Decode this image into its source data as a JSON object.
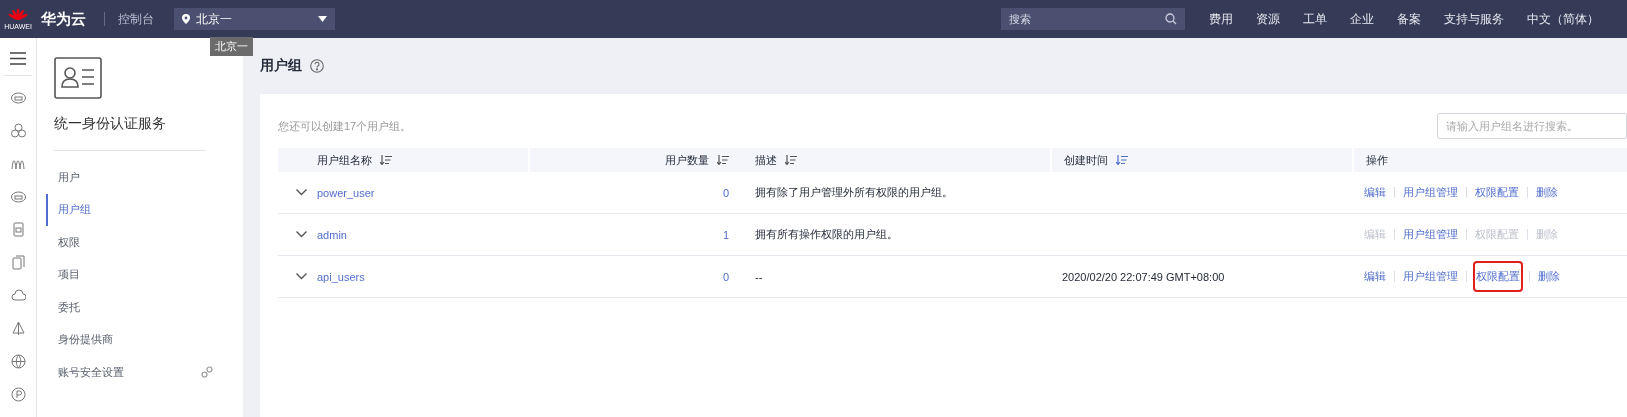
{
  "top_bar": {
    "logo_text": "HUAWEI",
    "brand": "华为云",
    "console": "控制台",
    "region": {
      "value": "北京一"
    },
    "region_tooltip": "北京一",
    "search": {
      "placeholder": "搜索"
    },
    "nav": [
      "费用",
      "资源",
      "工单",
      "企业",
      "备案",
      "支持与服务",
      "中文（简体）"
    ]
  },
  "sidebar": {
    "title": "统一身份认证服务",
    "items": [
      {
        "label": "用户",
        "selected": false,
        "link_icon": false
      },
      {
        "label": "用户组",
        "selected": true,
        "link_icon": false
      },
      {
        "label": "权限",
        "selected": false,
        "link_icon": false
      },
      {
        "label": "项目",
        "selected": false,
        "link_icon": false
      },
      {
        "label": "委托",
        "selected": false,
        "link_icon": false
      },
      {
        "label": "身份提供商",
        "selected": false,
        "link_icon": false
      },
      {
        "label": "账号安全设置",
        "selected": false,
        "link_icon": true
      }
    ]
  },
  "page": {
    "title": "用户组",
    "quota_hint": "您还可以创建17个用户组。",
    "search": {
      "placeholder": "请输入用户组名进行搜索。"
    },
    "table": {
      "columns": [
        {
          "label": "用户组名称",
          "sortable": true,
          "sorted": false
        },
        {
          "label": "用户数量",
          "sortable": true,
          "sorted": false
        },
        {
          "label": "描述",
          "sortable": true,
          "sorted": false
        },
        {
          "label": "创建时间",
          "sortable": true,
          "sorted": true
        },
        {
          "label": "操作"
        }
      ],
      "rows": [
        {
          "expanded": false,
          "name": "power_user",
          "user_count": "0",
          "description": "拥有除了用户管理外所有权限的用户组。",
          "created": "",
          "actions": [
            {
              "label": "编辑",
              "disabled": false,
              "highlighted": false
            },
            {
              "label": "用户组管理",
              "disabled": false,
              "highlighted": false
            },
            {
              "label": "权限配置",
              "disabled": false,
              "highlighted": false
            },
            {
              "label": "删除",
              "disabled": false,
              "highlighted": false
            }
          ]
        },
        {
          "expanded": false,
          "name": "admin",
          "user_count": "1",
          "description": "拥有所有操作权限的用户组。",
          "created": "",
          "actions": [
            {
              "label": "编辑",
              "disabled": true,
              "highlighted": false
            },
            {
              "label": "用户组管理",
              "disabled": false,
              "highlighted": false
            },
            {
              "label": "权限配置",
              "disabled": true,
              "highlighted": false
            },
            {
              "label": "删除",
              "disabled": true,
              "highlighted": false
            }
          ]
        },
        {
          "expanded": false,
          "name": "api_users",
          "user_count": "0",
          "description": "--",
          "created": "2020/02/20 22:07:49 GMT+08:00",
          "actions": [
            {
              "label": "编辑",
              "disabled": false,
              "highlighted": false
            },
            {
              "label": "用户组管理",
              "disabled": false,
              "highlighted": false
            },
            {
              "label": "权限配置",
              "disabled": false,
              "highlighted": true
            },
            {
              "label": "删除",
              "disabled": false,
              "highlighted": false
            }
          ]
        }
      ]
    }
  }
}
